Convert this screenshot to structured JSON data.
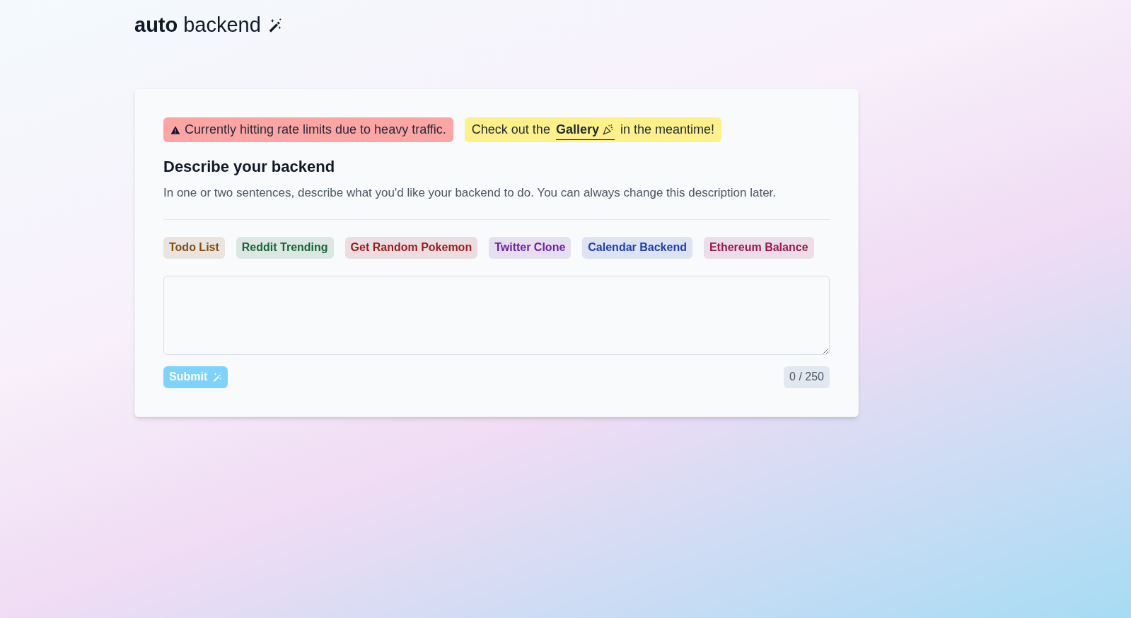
{
  "logo": {
    "bold": "auto",
    "regular": "backend"
  },
  "notices": [
    {
      "kind": "warning",
      "text": "Currently hitting rate limits due to heavy traffic."
    },
    {
      "kind": "info",
      "before": "Check out the",
      "link": "Gallery",
      "after": "in the meantime!"
    }
  ],
  "heading": "Describe your backend",
  "description": "In one or two sentences, describe what you'd like your backend to do. You can always change this description later.",
  "examples": [
    {
      "label": "Todo List",
      "color": "#854d0e"
    },
    {
      "label": "Reddit Trending",
      "color": "#166534"
    },
    {
      "label": "Get Random Pokemon",
      "color": "#991b1b"
    },
    {
      "label": "Twitter Clone",
      "color": "#6b21a8"
    },
    {
      "label": "Calendar Backend",
      "color": "#1e40af"
    },
    {
      "label": "Ethereum Balance",
      "color": "#9d174d"
    }
  ],
  "submit": {
    "label": "Submit",
    "disabled": true
  },
  "counter": "0 / 250"
}
